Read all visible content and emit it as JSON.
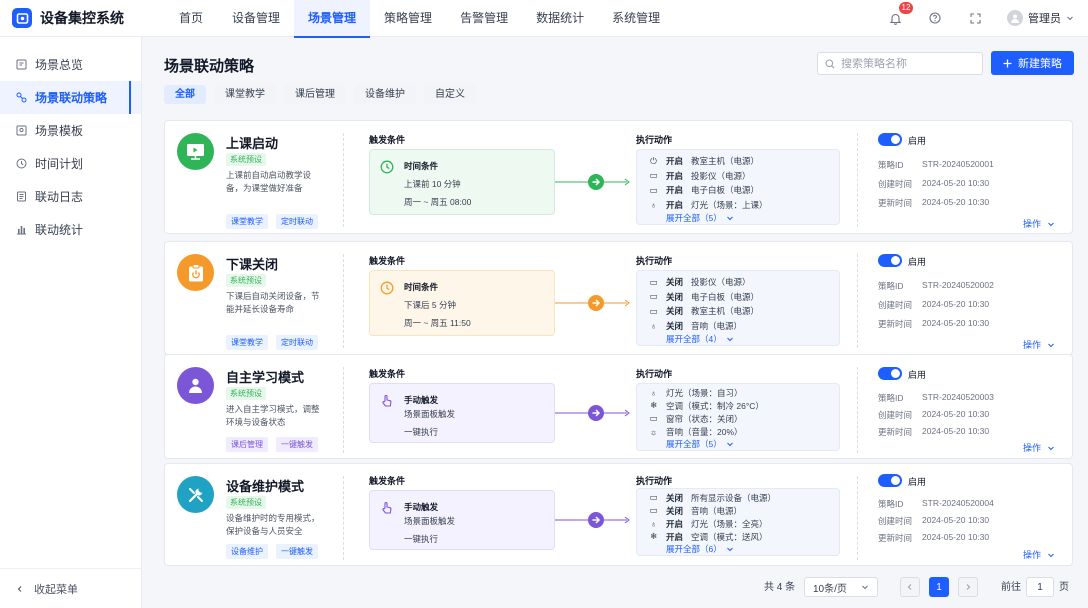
{
  "app": {
    "title": "设备集控系统"
  },
  "nav": [
    "首页",
    "设备管理",
    "场景管理",
    "策略管理",
    "告警管理",
    "数据统计",
    "系统管理"
  ],
  "notifications": {
    "count": "12"
  },
  "user": {
    "name": "管理员"
  },
  "sidebar": {
    "items": [
      "场景总览",
      "场景联动策略",
      "场景模板",
      "时间计划",
      "联动日志",
      "联动统计"
    ],
    "collapse": "收起菜单"
  },
  "page": {
    "title": "场景联动策略",
    "search_placeholder": "搜索策略名称",
    "new_button": "新建策略"
  },
  "tabs": [
    "全部",
    "课堂教学",
    "课后管理",
    "设备维护",
    "自定义"
  ],
  "labels": {
    "trigger": "触发条件",
    "action": "执行动作",
    "enabled": "启用",
    "id": "策略ID",
    "created": "创建时间",
    "updated": "更新时间",
    "ops": "操作"
  },
  "strategies": [
    {
      "name": "上课启动",
      "badge": "系统预设",
      "desc": "上课前自动启动教学设备，为课堂做好准备",
      "tags": [
        "课堂教学",
        "定时联动"
      ],
      "trigger": {
        "title": "时间条件",
        "l1": "上课前 10 分钟",
        "l2": "周一 ~ 周五 08:00"
      },
      "actions": [
        {
          "verb": "开启",
          "text": "教室主机（电源）",
          "icon": "power-icon"
        },
        {
          "verb": "开启",
          "text": "投影仪（电源）",
          "icon": "projector-icon"
        },
        {
          "verb": "开启",
          "text": "电子白板（电源）",
          "icon": "whiteboard-icon"
        },
        {
          "verb": "开启",
          "text": "灯光（场景：上课）",
          "icon": "bulb-icon"
        }
      ],
      "more": "展开全部（5）",
      "id": "STR-20240520001",
      "created": "2024-05-20 10:30",
      "updated": "2024-05-20 10:30"
    },
    {
      "name": "下课关闭",
      "badge": "系统预设",
      "desc": "下课后自动关闭设备，节能并延长设备寿命",
      "tags": [
        "课堂教学",
        "定时联动"
      ],
      "trigger": {
        "title": "时间条件",
        "l1": "下课后 5 分钟",
        "l2": "周一 ~ 周五 11:50"
      },
      "actions": [
        {
          "verb": "关闭",
          "text": "投影仪（电源）",
          "icon": "projector-icon"
        },
        {
          "verb": "关闭",
          "text": "电子白板（电源）",
          "icon": "whiteboard-icon"
        },
        {
          "verb": "关闭",
          "text": "教室主机（电源）",
          "icon": "power-icon"
        },
        {
          "verb": "关闭",
          "text": "音响（电源）",
          "icon": "bulb-icon"
        }
      ],
      "more": "展开全部（4）",
      "id": "STR-20240520002",
      "created": "2024-05-20 10:30",
      "updated": "2024-05-20 10:30"
    },
    {
      "name": "自主学习模式",
      "badge": "系统预设",
      "desc": "进入自主学习模式，调整环境与设备状态",
      "tags": [
        "课后管理",
        "一键触发"
      ],
      "trigger": {
        "title": "手动触发",
        "l1": "场景面板触发",
        "l2": "一键执行"
      },
      "actions": [
        {
          "verb": "",
          "text": "灯光（场景：自习）",
          "icon": "bulb-icon"
        },
        {
          "verb": "",
          "text": "空调（模式：制冷 26°C）",
          "icon": "snowflake-icon"
        },
        {
          "verb": "",
          "text": "窗帘（状态：关闭）",
          "icon": "curtain-icon"
        },
        {
          "verb": "",
          "text": "音响（音量：20%）",
          "icon": "sun-icon"
        }
      ],
      "more": "展开全部（5）",
      "id": "STR-20240520003",
      "created": "2024-05-20 10:30",
      "updated": "2024-05-20 10:30"
    },
    {
      "name": "设备维护模式",
      "badge": "系统预设",
      "desc": "设备维护时的专用模式，保护设备与人员安全",
      "tags": [
        "设备维护",
        "一键触发"
      ],
      "trigger": {
        "title": "手动触发",
        "l1": "场景面板触发",
        "l2": "一键执行"
      },
      "actions": [
        {
          "verb": "关闭",
          "text": "所有显示设备（电源）",
          "icon": "projector-icon"
        },
        {
          "verb": "关闭",
          "text": "音响（电源）",
          "icon": "whiteboard-icon"
        },
        {
          "verb": "开启",
          "text": "灯光（场景：全亮）",
          "icon": "bulb-icon"
        },
        {
          "verb": "开启",
          "text": "空调（模式：送风）",
          "icon": "snowflake-icon"
        }
      ],
      "more": "展开全部（6）",
      "id": "STR-20240520004",
      "created": "2024-05-20 10:30",
      "updated": "2024-05-20 10:30"
    }
  ],
  "pagination": {
    "total": "共 4 条",
    "page_size": "10条/页",
    "current": "1",
    "goto_label": "前往",
    "goto_value": "1",
    "page_unit": "页"
  },
  "colors": {
    "primary": "#1e5eff",
    "green": "#2fb457",
    "orange": "#f59a2a",
    "purple": "#7b56d6",
    "teal": "#1fa2c3"
  }
}
